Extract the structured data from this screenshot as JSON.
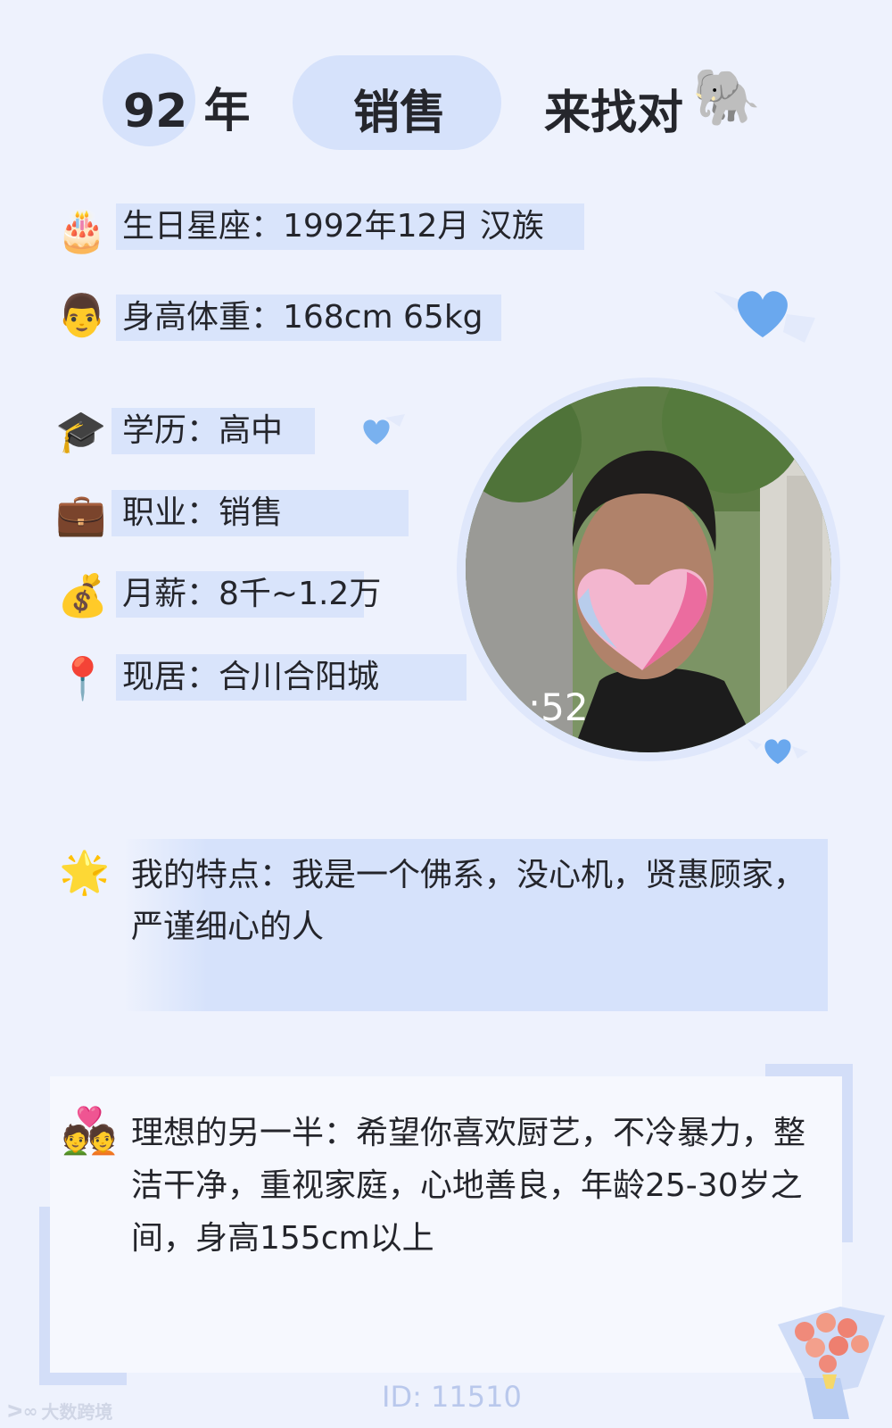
{
  "header": {
    "age": "92 年",
    "job": "销售",
    "seeking": "来找对",
    "seeking_icon": "elephant-icon"
  },
  "info_rows": [
    {
      "icon": "birthday-cake-icon",
      "glyph": "🎂",
      "text": "生日星座：1992年12月 汉族"
    },
    {
      "icon": "man-face-icon",
      "glyph": "👨",
      "text": "身高体重：168cm 65kg"
    },
    {
      "icon": "graduation-cap-icon",
      "glyph": "🎓",
      "text": "学历：高中"
    },
    {
      "icon": "briefcase-icon",
      "glyph": "💼",
      "text": "职业：销售"
    },
    {
      "icon": "money-bag-icon",
      "glyph": "💰",
      "text": "月薪：8千~1.2万"
    },
    {
      "icon": "location-pin-icon",
      "glyph": "📍",
      "text": "现居：合川合阳城"
    }
  ],
  "photo": {
    "overlay_text": ":52"
  },
  "features": {
    "icon": "star-icon",
    "glyph": "🌟",
    "text": "我的特点：我是一个佛系，没心机，贤惠顾家，严谨细心的人"
  },
  "ideal": {
    "icon": "couple-with-heart-icon",
    "glyph": "💑",
    "text": "理想的另一半：希望你喜欢厨艺，不冷暴力，整洁干净，重视家庭，心地善良，年龄25-30岁之间，身高155cm以上"
  },
  "footer": {
    "id": "ID: 11510",
    "watermark": "大数跨境"
  },
  "colors": {
    "background": "#eef2fd",
    "bar": "#d9e4fb",
    "heart": "#6aa8ee",
    "id_text": "#b9c8ec"
  }
}
